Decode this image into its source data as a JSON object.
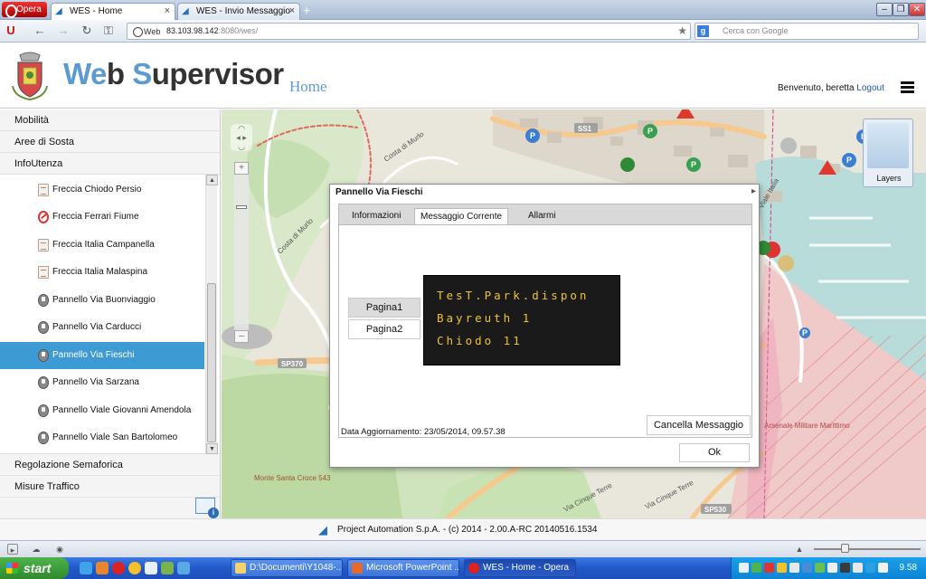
{
  "browser": {
    "opera_button": "Opera",
    "tabs": [
      {
        "title": "WES - Home",
        "active": true
      },
      {
        "title": "WES - Invio Messaggio",
        "active": false
      }
    ],
    "new_tab": "+",
    "web_label": "Web",
    "url_host": "83.103.98.142",
    "url_rest": ":8080/wes/",
    "search_placeholder": "Cerca con Google"
  },
  "header": {
    "brand_part1_hl": "We",
    "brand_part1": "b ",
    "brand_part2_hl": "S",
    "brand_part2": "upervisor",
    "page_name": "Home",
    "welcome": "Benvenuto, beretta",
    "logout": "Logout"
  },
  "sidebar": {
    "top_categories": [
      "Mobilità",
      "Aree di Sosta",
      "InfoUtenza"
    ],
    "items": [
      {
        "label": "Freccia Chiodo Persio",
        "icon": "arrow-sign-icon"
      },
      {
        "label": "Freccia Ferrari Fiume",
        "icon": "no-entry-icon"
      },
      {
        "label": "Freccia Italia Campanella",
        "icon": "arrow-sign-icon"
      },
      {
        "label": "Freccia Italia Malaspina",
        "icon": "arrow-sign-icon"
      },
      {
        "label": "Pannello Via Buonviaggio",
        "icon": "panel-icon"
      },
      {
        "label": "Pannello Via Carducci",
        "icon": "panel-icon"
      },
      {
        "label": "Pannello Via Fieschi",
        "icon": "panel-icon",
        "selected": true
      },
      {
        "label": "Pannello Via Sarzana",
        "icon": "panel-icon"
      },
      {
        "label": "Pannello Viale Giovanni Amendola",
        "icon": "panel-icon"
      },
      {
        "label": "Pannello Viale San Bartolomeo",
        "icon": "panel-icon"
      }
    ],
    "bottom_categories": [
      "Regolazione Semaforica",
      "Misure Traffico"
    ]
  },
  "map": {
    "labels": [
      "Costa di Murlo",
      "Costa di Murlo",
      "SP370",
      "SS1",
      "SP530",
      "Via Cinque Terre",
      "Via Cinque Terre",
      "Monte Santa Croce 543",
      "Arsenale Militare Marittimo",
      "Viale Italia"
    ],
    "layers_label": "Layers"
  },
  "dialog": {
    "title": "Pannello Via Fieschi",
    "tabs": [
      "Informazioni",
      "Messaggio Corrente",
      "Allarmi"
    ],
    "active_tab": "Messaggio Corrente",
    "pages": [
      "Pagina1",
      "Pagina2"
    ],
    "active_page": "Pagina1",
    "message_lines": [
      "TesT.Park.dispon",
      "Bayreuth 1",
      "Chiodo 11"
    ],
    "updated": "Data Aggiornamento: 23/05/2014, 09.57.38",
    "cancel_label": "Cancella Messaggio",
    "ok_label": "Ok"
  },
  "footer": {
    "text": "Project Automation S.p.A. - (c) 2014 - 2.00.A-RC 20140516.1534"
  },
  "taskbar": {
    "start": "start",
    "tasks": [
      {
        "label": "D:\\Documenti\\Y1048-...",
        "active": false
      },
      {
        "label": "Microsoft PowerPoint ...",
        "active": false
      },
      {
        "label": "WES - Home - Opera",
        "active": true
      }
    ],
    "clock": "9.58"
  },
  "colors": {
    "brand_blue": "#5b9bd0",
    "selection": "#3d9ad2",
    "led_text": "#f0c230"
  }
}
